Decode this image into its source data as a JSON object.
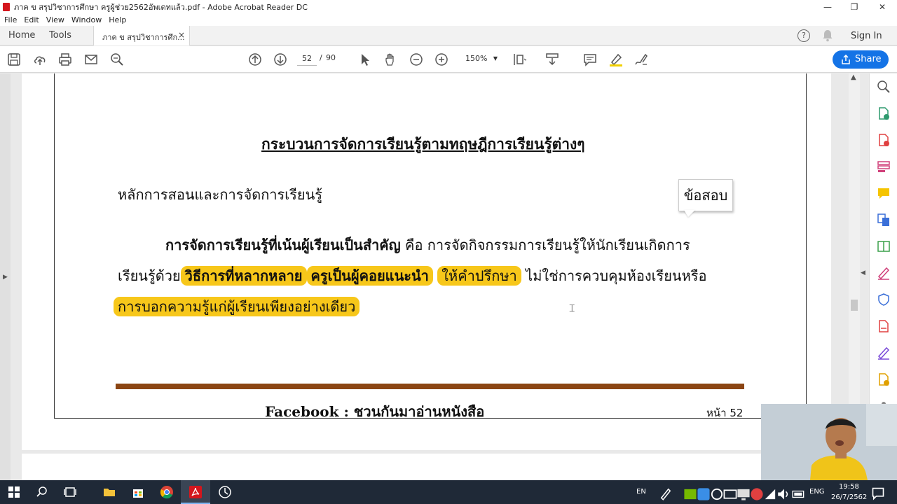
{
  "window": {
    "title": "ภาค ข สรุปวิชาการศึกษา ครูผู้ช่วย2562อัพเดทแล้ว.pdf - Adobe Acrobat Reader DC",
    "minimize": "—",
    "maximize": "❐",
    "close": "✕"
  },
  "menu": {
    "items": [
      "File",
      "Edit",
      "View",
      "Window",
      "Help"
    ]
  },
  "tabs": {
    "home": "Home",
    "tools": "Tools",
    "doc": "ภาค ข สรุปวิชาการศึก...",
    "close": "×",
    "signin": "Sign In",
    "help": "?"
  },
  "toolbar": {
    "page_current": "52",
    "page_sep": "/",
    "page_total": "90",
    "zoom": "150%",
    "share": "Share"
  },
  "document": {
    "heading": "กระบวนการจัดการเรียนรู้ตามทฤษฎีการเรียนรู้ต่างๆ",
    "subheading": "หลักการสอนและการจัดการเรียนรู้",
    "callout": "ข้อสอบ",
    "p1_bold": "การจัดการเรียนรู้ที่เน้นผู้เรียนเป็นสำคัญ",
    "p1_rest": " คือ การจัดกิจกรรมการเรียนรู้ให้นักเรียนเกิดการ",
    "p2_start": "เรียนรู้ด้วย",
    "p2_hl1": "วิธีการที่หลากหลาย",
    "p2_hl2": "ครูเป็นผู้คอยแนะนำ",
    "p2_hl3": "ให้คำปรึกษา",
    "p2_end": " ไม่ใช่การควบคุมห้องเรียนหรือ",
    "p3_hl": "การบอกความรู้แก่ผู้เรียนเพียงอย่างเดียว",
    "footer_fb": "Facebook : ชวนกันมาอ่านหนังสือ",
    "footer_page": "หน้า 52"
  },
  "taskbar": {
    "lang_short": "EN",
    "lang": "ENG",
    "time": "19:58",
    "date": "26/7/2562"
  },
  "colors": {
    "accent": "#1473e6",
    "highlight": "#f7c71a",
    "divider": "#8b4513",
    "pdf_red": "#d4161d"
  },
  "icons": {
    "toolbar": [
      "save-icon",
      "upload-icon",
      "print-icon",
      "email-icon",
      "zoom-search-icon",
      "page-up-icon",
      "page-down-icon",
      "select-pointer-icon",
      "hand-icon",
      "zoom-out-icon",
      "zoom-in-icon",
      "page-view-icon",
      "scroll-mode-icon",
      "comment-icon",
      "highlight-icon",
      "sign-icon"
    ],
    "toolpane": [
      "search-icon",
      "export-pdf-icon",
      "create-pdf-icon",
      "edit-pdf-icon",
      "comment-icon",
      "combine-icon",
      "organize-icon",
      "fill-sign-icon",
      "protect-icon",
      "pdf-icon",
      "sign-icon",
      "send-icon",
      "more-icon"
    ]
  }
}
